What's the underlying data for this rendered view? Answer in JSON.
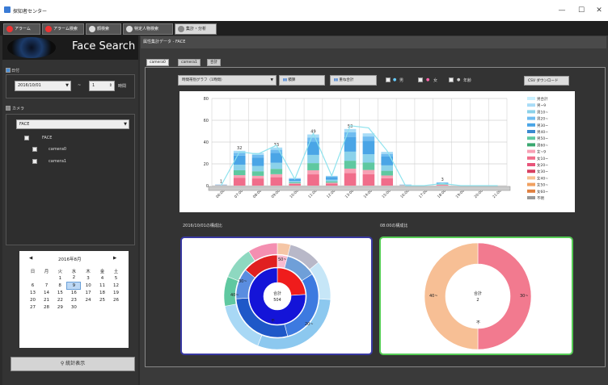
{
  "window": {
    "title": "探知者センター",
    "min": "—",
    "max": "☐",
    "close": "✕"
  },
  "tabs": [
    {
      "label": "アラーム"
    },
    {
      "label": "アラーム検索"
    },
    {
      "label": "顔検索"
    },
    {
      "label": "特定人物検索"
    },
    {
      "label": "集計・分析"
    }
  ],
  "logo": {
    "text": "Face Search"
  },
  "date_section": {
    "label": "日付",
    "date_value": "2016/10/01",
    "sep": "~",
    "hours_value": "1",
    "hours_unit": "時間"
  },
  "camera_section": {
    "label": "カメラ",
    "group_select": "FACE",
    "tree": [
      {
        "label": "FACE"
      },
      {
        "label": "camera0"
      },
      {
        "label": "camera1"
      }
    ]
  },
  "calendar": {
    "title": "2016年8月",
    "prev": "◀",
    "next": "▶",
    "weekdays": [
      "日",
      "月",
      "火",
      "水",
      "木",
      "金",
      "土"
    ],
    "weeks": [
      [
        "",
        "",
        "",
        "",
        "",
        "",
        ""
      ],
      [
        "",
        "",
        "",
        "1",
        "2",
        "3",
        "4",
        "5",
        "6"
      ]
    ],
    "rows": [
      [
        "",
        "",
        "1",
        "2",
        "3",
        "4",
        "5"
      ],
      [
        "6",
        "7",
        "8",
        "9",
        "10",
        "11",
        "12"
      ],
      [
        "13",
        "14",
        "15",
        "16",
        "17",
        "18",
        "19"
      ],
      [
        "20",
        "21",
        "22",
        "23",
        "24",
        "25",
        "26"
      ],
      [
        "27",
        "28",
        "29",
        "30",
        "",
        "",
        ""
      ]
    ],
    "today": "9"
  },
  "stats_button": {
    "label": "統計表示",
    "icon": "magnifier-icon"
  },
  "right": {
    "header": "属性集計データ - FACE",
    "tabs": [
      {
        "label": "camera0"
      },
      {
        "label": "camera1"
      },
      {
        "label": "合計"
      }
    ],
    "graph_select": "時間帯別グラフ（1時間）",
    "btn_stack": "積算",
    "btn_sum": "重ね合計",
    "filter_labels": [
      "男",
      "女",
      "年齢"
    ],
    "csv_button": "CSV ダウンロード"
  },
  "chart_data": {
    "type": "bar",
    "ylim": [
      0,
      80
    ],
    "yticks": [
      "0",
      "20",
      "40",
      "60",
      "80"
    ],
    "categories": [
      "06:00",
      "07:00",
      "08:00",
      "09:00",
      "10:00",
      "11:00",
      "12:00",
      "13:00",
      "14:00",
      "15:00",
      "16:00",
      "17:00",
      "18:00",
      "19:00",
      "20:00",
      "21:00"
    ],
    "totals": [
      1,
      32,
      30,
      35,
      7,
      47,
      9,
      52,
      48,
      31,
      1,
      0,
      3,
      0,
      0,
      0
    ],
    "total_labels": [
      "1",
      "32",
      "",
      "33",
      "",
      "49",
      "",
      "53",
      "",
      "",
      "",
      "",
      "3",
      "",
      "",
      ""
    ],
    "line": [
      0,
      31,
      29,
      37,
      6,
      48,
      9,
      55,
      53,
      32,
      0,
      0,
      2,
      0,
      0,
      0
    ],
    "legend": [
      "男合計",
      "男~9",
      "男10~",
      "男20~",
      "男30~",
      "男40~",
      "男50~",
      "男60~",
      "女~9",
      "女10~",
      "女20~",
      "女30~",
      "女40~",
      "女50~",
      "女60~",
      "不明"
    ]
  },
  "donuts": [
    {
      "title": "2016/10/01の構成比",
      "center_label": "合計",
      "center_value": "504",
      "labels": [
        "50~",
        "40~",
        "30~",
        "20~",
        "不"
      ]
    },
    {
      "title": "08:00の構成比",
      "center_label": "合計",
      "center_value": "2",
      "labels": [
        "40~",
        "30~",
        "不"
      ]
    }
  ]
}
